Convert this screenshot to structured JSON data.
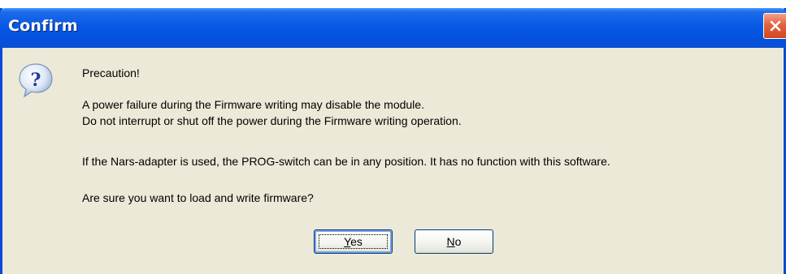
{
  "window": {
    "title": "Confirm",
    "close_label": "Close"
  },
  "icon": "question-icon",
  "message": {
    "line1": "Precaution!",
    "line2": "A power failure during the Firmware writing may disable the module.",
    "line3": "Do not interrupt or shut off the power during the Firmware writing operation.",
    "line4": "If the Nars-adapter is used, the PROG-switch can be in any position. It has no function with this software.",
    "line5": "Are sure you want to load and write firmware?"
  },
  "buttons": {
    "yes_mnemonic": "Y",
    "yes_rest": "es",
    "no_mnemonic": "N",
    "no_rest": "o"
  },
  "colors": {
    "titlebar": "#0758e6",
    "dialog_bg": "#ece9d8",
    "close_button": "#e2623f"
  }
}
